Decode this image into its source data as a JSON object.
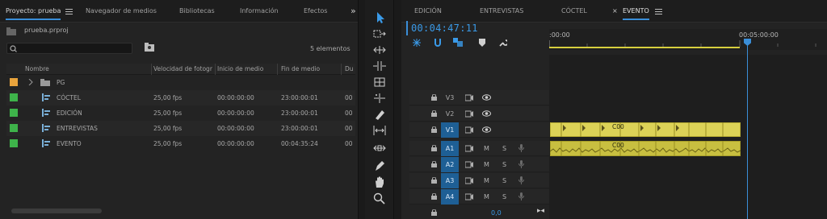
{
  "project_panel": {
    "tabs": [
      {
        "label": "Proyecto: prueba",
        "active": true
      },
      {
        "label": "Navegador de medios"
      },
      {
        "label": "Bibliotecas"
      },
      {
        "label": "Información"
      },
      {
        "label": "Efectos"
      }
    ],
    "overflow": "»",
    "project_file": "prueba.prproj",
    "search_placeholder": "",
    "item_count": "5 elementos",
    "columns": [
      "Nombre",
      "Velocidad de fotogr",
      "Inicio de medio",
      "Fin de medio",
      "Du"
    ],
    "rows": [
      {
        "color": "#e8a33c",
        "type": "bin",
        "name": "PG",
        "fps": "",
        "start": "",
        "end": "",
        "dur": ""
      },
      {
        "color": "#3eb34a",
        "type": "sequence",
        "name": "CÓCTEL",
        "fps": "25,00 fps",
        "start": "00:00:00:00",
        "end": "23:00:00:01",
        "dur": "00"
      },
      {
        "color": "#3eb34a",
        "type": "sequence",
        "name": "EDICIÓN",
        "fps": "25,00 fps",
        "start": "00:00:00:00",
        "end": "23:00:00:01",
        "dur": "00"
      },
      {
        "color": "#3eb34a",
        "type": "sequence",
        "name": "ENTREVISTAS",
        "fps": "25,00 fps",
        "start": "00:00:00:00",
        "end": "23:00:00:01",
        "dur": "00"
      },
      {
        "color": "#3eb34a",
        "type": "sequence",
        "name": "EVENTO",
        "fps": "25,00 fps",
        "start": "00:00:00:00",
        "end": "00:04:35:24",
        "dur": "00"
      }
    ]
  },
  "timeline": {
    "tabs": [
      {
        "label": "EDICIÓN"
      },
      {
        "label": "ENTREVISTAS"
      },
      {
        "label": "CÓCTEL"
      },
      {
        "label": "EVENTO",
        "active": true
      }
    ],
    "close_glyph": "×",
    "timecode": "00:04:47:11",
    "ruler": [
      ":00:00",
      "00:05:00:00"
    ],
    "tracks": [
      {
        "label": "V3",
        "kind": "video",
        "on": false
      },
      {
        "label": "V2",
        "kind": "video",
        "on": false
      },
      {
        "label": "V1",
        "kind": "video",
        "on": true
      },
      {
        "label": "A1",
        "kind": "audio",
        "on": true
      },
      {
        "label": "A2",
        "kind": "audio",
        "on": true
      },
      {
        "label": "A3",
        "kind": "audio",
        "on": true
      },
      {
        "label": "A4",
        "kind": "audio",
        "on": true
      }
    ],
    "mute_letter": "M",
    "solo_letter": "S",
    "clip_label": "C00",
    "master_value": "0,0",
    "master_glyph": "▸◂"
  }
}
